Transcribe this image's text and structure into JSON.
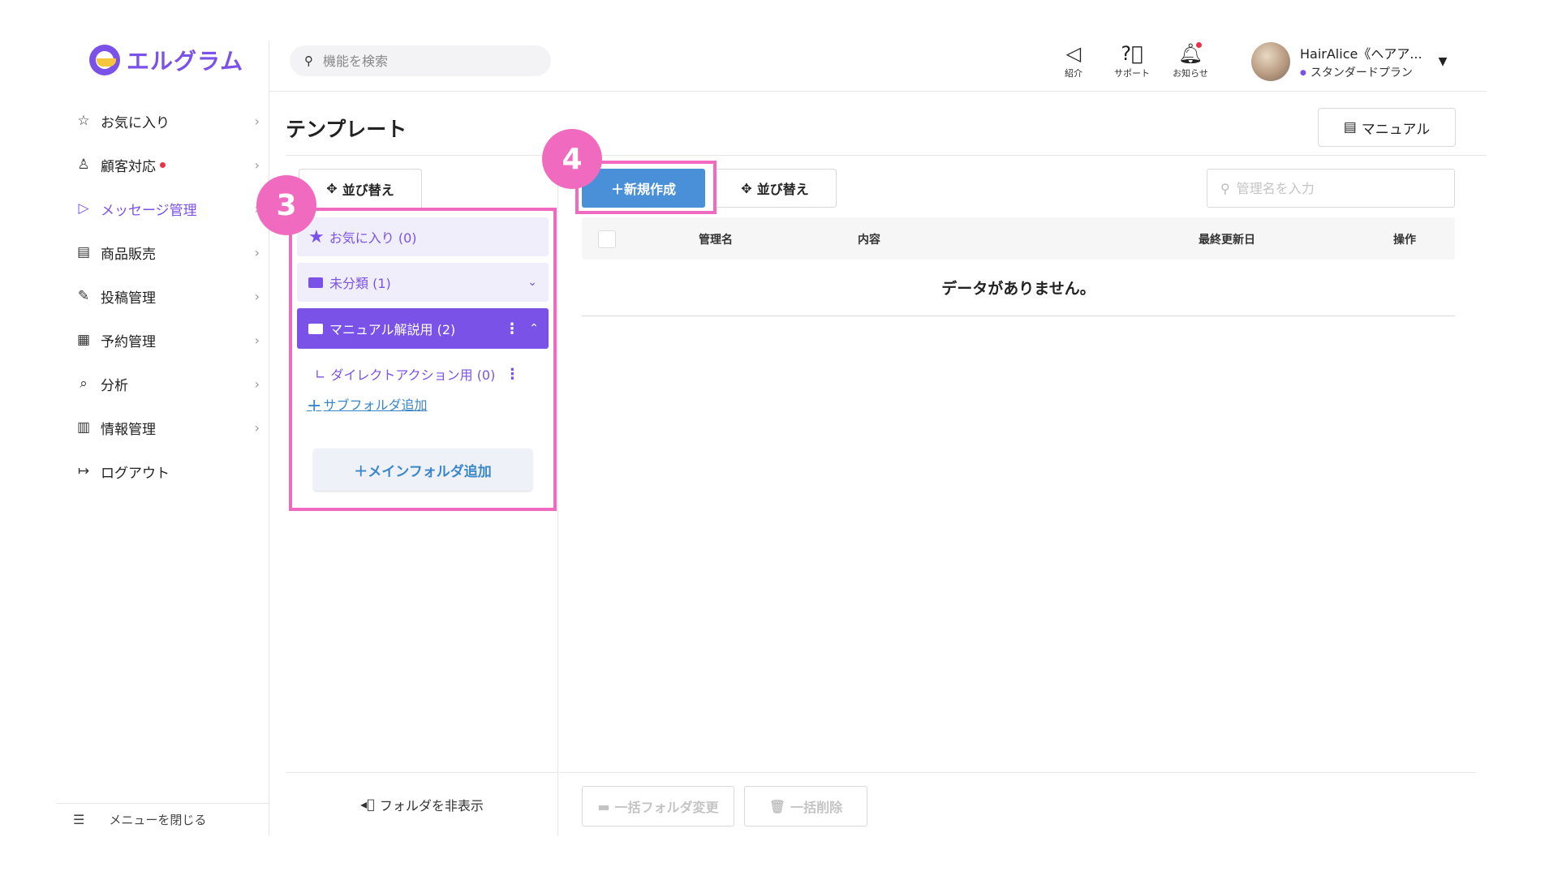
{
  "app": {
    "logo_text": "エルグラム",
    "brand_color": "#7b52e8"
  },
  "search": {
    "placeholder": "機能を検索"
  },
  "top_icons": [
    {
      "icon": "megaphone-icon",
      "label": "紹介"
    },
    {
      "icon": "question-circle-icon",
      "label": "サポート"
    },
    {
      "icon": "bell-icon",
      "label": "お知らせ"
    }
  ],
  "user": {
    "name": "HairAlice《ヘアア...",
    "plan": "スタンダードプラン"
  },
  "sidebar": {
    "items": [
      {
        "label": "お気に入り",
        "icon": "star-icon"
      },
      {
        "label": "顧客対応",
        "icon": "person-icon",
        "dot": true
      },
      {
        "label": "メッセージ管理",
        "icon": "send-icon",
        "active": true
      },
      {
        "label": "商品販売",
        "icon": "store-icon"
      },
      {
        "label": "投稿管理",
        "icon": "edit-icon"
      },
      {
        "label": "予約管理",
        "icon": "calendar-icon"
      },
      {
        "label": "分析",
        "icon": "report-icon"
      },
      {
        "label": "情報管理",
        "icon": "chart-icon"
      },
      {
        "label": "ログアウト",
        "icon": "logout-icon"
      }
    ],
    "close_label": "メニューを閉じる"
  },
  "page": {
    "title": "テンプレート",
    "manual_label": "マニュアル"
  },
  "folders": {
    "sort_label": "並び替え",
    "favorite": "お気に入り (0)",
    "uncategorized": "未分類 (1)",
    "manual_folder": "マニュアル解説用 (2)",
    "subfolder": "ダイレクトアクション用 (0)",
    "add_sub": "サブフォルダ追加",
    "add_main": "＋メインフォルダ追加",
    "hide_label": "フォルダを非表示"
  },
  "main": {
    "new_label": "＋新規作成",
    "sort_label": "並び替え",
    "search_placeholder": "管理名を入力",
    "columns": [
      "管理名",
      "内容",
      "最終更新日",
      "操作"
    ],
    "empty_message": "データがありません。",
    "bulk_folder": "一括フォルダ変更",
    "bulk_delete": "一括削除"
  },
  "annotations": {
    "badge_3": "3",
    "badge_4": "4",
    "highlight_color": "#f06bbf"
  }
}
